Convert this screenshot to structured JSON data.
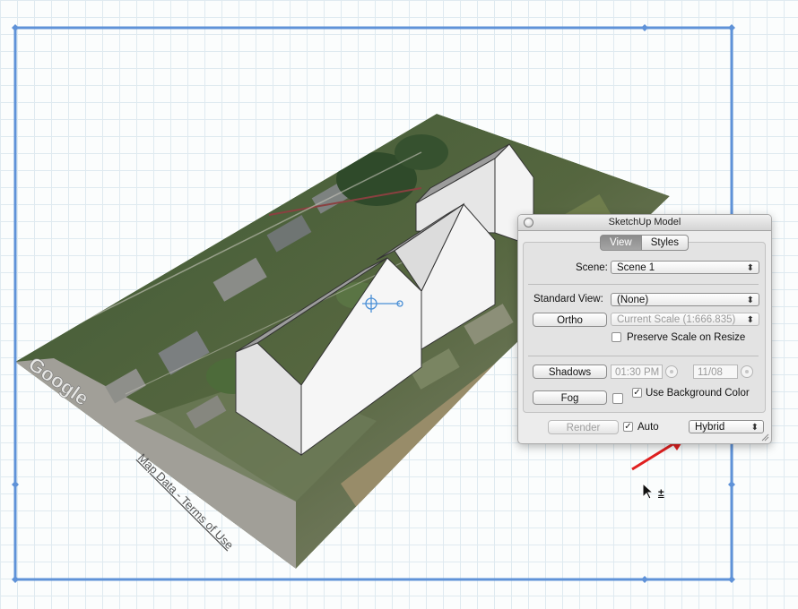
{
  "map": {
    "watermark": "Google",
    "attribution": "Map Data - Terms of Use"
  },
  "panel": {
    "title": "SketchUp Model",
    "tabs": [
      "View",
      "Styles"
    ],
    "active_tab": "View",
    "scene_label": "Scene:",
    "scene_value": "Scene 1",
    "standard_view_label": "Standard View:",
    "standard_view_value": "(None)",
    "ortho_label": "Ortho",
    "scale_value": "Current Scale (1:666.835)",
    "preserve_scale_label": "Preserve Scale on Resize",
    "preserve_scale_checked": false,
    "shadows_label": "Shadows",
    "shadow_time": "01:30 PM",
    "shadow_date": "11/08",
    "fog_label": "Fog",
    "use_bg_color_label": "Use Background Color",
    "use_bg_color_checked": true,
    "render_label": "Render",
    "auto_label": "Auto",
    "auto_checked": true,
    "render_mode": "Hybrid"
  },
  "annotation": {
    "arrow_color": "#e02020"
  },
  "colors": {
    "selection_frame": "#5f92d8",
    "grid": "#dfeaf0"
  },
  "cursor": {
    "glyph": "±"
  }
}
